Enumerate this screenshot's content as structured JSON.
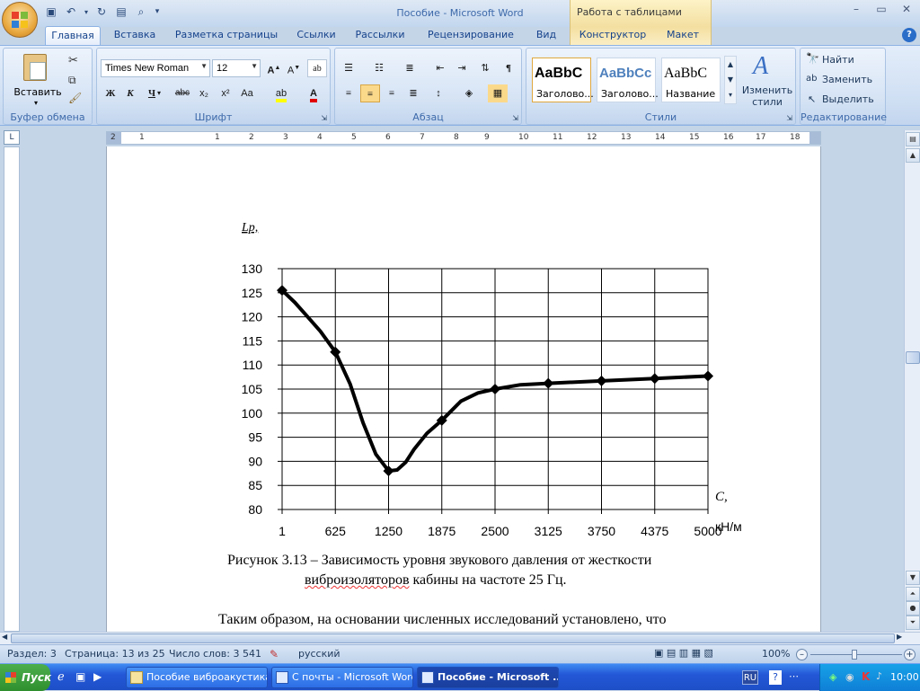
{
  "window": {
    "title": "Пособие - Microsoft Word",
    "contextual_tab_group": "Работа с таблицами"
  },
  "tabs": [
    "Главная",
    "Вставка",
    "Разметка страницы",
    "Ссылки",
    "Рассылки",
    "Рецензирование",
    "Вид",
    "Конструктор",
    "Макет"
  ],
  "ribbon": {
    "clipboard": {
      "paste_label": "Вставить",
      "group_label": "Буфер обмена"
    },
    "font": {
      "font_name": "Times New Roman",
      "font_size": "12",
      "group_label": "Шрифт",
      "bold": "Ж",
      "italic": "К",
      "underline": "Ч",
      "strike": "abc",
      "subscript": "x₂",
      "superscript": "x²",
      "case": "Aa"
    },
    "paragraph": {
      "group_label": "Абзац"
    },
    "styles": {
      "group_label": "Стили",
      "items": [
        {
          "sample": "AaBbC",
          "name": "Заголово..."
        },
        {
          "sample": "AaBbCc",
          "name": "Заголово..."
        },
        {
          "sample": "AaBbC",
          "name": "Название"
        }
      ],
      "change_styles": "Изменить стили"
    },
    "editing": {
      "group_label": "Редактирование",
      "find": "Найти",
      "replace": "Заменить",
      "select": "Выделить"
    }
  },
  "ruler": {
    "numbers": [
      "2",
      "1",
      "1",
      "2",
      "3",
      "4",
      "5",
      "6",
      "7",
      "8",
      "9",
      "10",
      "11",
      "12",
      "13",
      "14",
      "15",
      "16",
      "17",
      "18"
    ]
  },
  "document": {
    "caption_line1": "Рисунок 3.13 – Зависимость уровня звукового давления от жесткости",
    "caption_line2_part1": "виброизоляторов",
    "caption_line2_part2": " кабины на частоте 25 Гц.",
    "paragraph": "Таким образом, на основании численных исследований установлено, что"
  },
  "chart_data": {
    "type": "line",
    "ylabel": "Lp,",
    "xlabel": "C,",
    "xunit": "кН/м",
    "x_tick_labels": [
      "1",
      "625",
      "1250",
      "1875",
      "2500",
      "3125",
      "3750",
      "4375",
      "5000"
    ],
    "y_tick_labels": [
      "130",
      "125",
      "120",
      "115",
      "110",
      "105",
      "100",
      "95",
      "90",
      "85",
      "80"
    ],
    "ylim": [
      80,
      130
    ],
    "xlim": [
      1,
      5000
    ],
    "grid": true,
    "series": [
      {
        "markers": [
          [
            1,
            125.5
          ],
          [
            625,
            112.7
          ],
          [
            1250,
            88.0
          ],
          [
            1875,
            98.5
          ],
          [
            2500,
            105.0
          ],
          [
            3125,
            106.2
          ],
          [
            3750,
            106.7
          ],
          [
            4375,
            107.2
          ],
          [
            5000,
            107.7
          ]
        ],
        "curve": [
          [
            1,
            125.5
          ],
          [
            150,
            123.0
          ],
          [
            300,
            120.0
          ],
          [
            450,
            117.0
          ],
          [
            625,
            112.7
          ],
          [
            800,
            106.0
          ],
          [
            950,
            98.0
          ],
          [
            1100,
            91.5
          ],
          [
            1250,
            88.0
          ],
          [
            1350,
            88.2
          ],
          [
            1450,
            89.8
          ],
          [
            1550,
            92.5
          ],
          [
            1700,
            95.8
          ],
          [
            1875,
            98.5
          ],
          [
            2100,
            102.5
          ],
          [
            2300,
            104.2
          ],
          [
            2500,
            105.0
          ],
          [
            2800,
            105.9
          ],
          [
            3125,
            106.2
          ],
          [
            3750,
            106.7
          ],
          [
            4375,
            107.2
          ],
          [
            5000,
            107.7
          ]
        ]
      }
    ]
  },
  "statusbar": {
    "section": "Раздел: 3",
    "page": "Страница: 13 из 25",
    "words": "Число слов: 3 541",
    "language": "русский",
    "zoom": "100%"
  },
  "taskbar": {
    "start": "Пуск",
    "tasks": [
      "Пособие виброакустика",
      "С почты - Microsoft Word",
      "Пособие - Microsoft ..."
    ],
    "lang": "RU",
    "time": "10:00"
  }
}
